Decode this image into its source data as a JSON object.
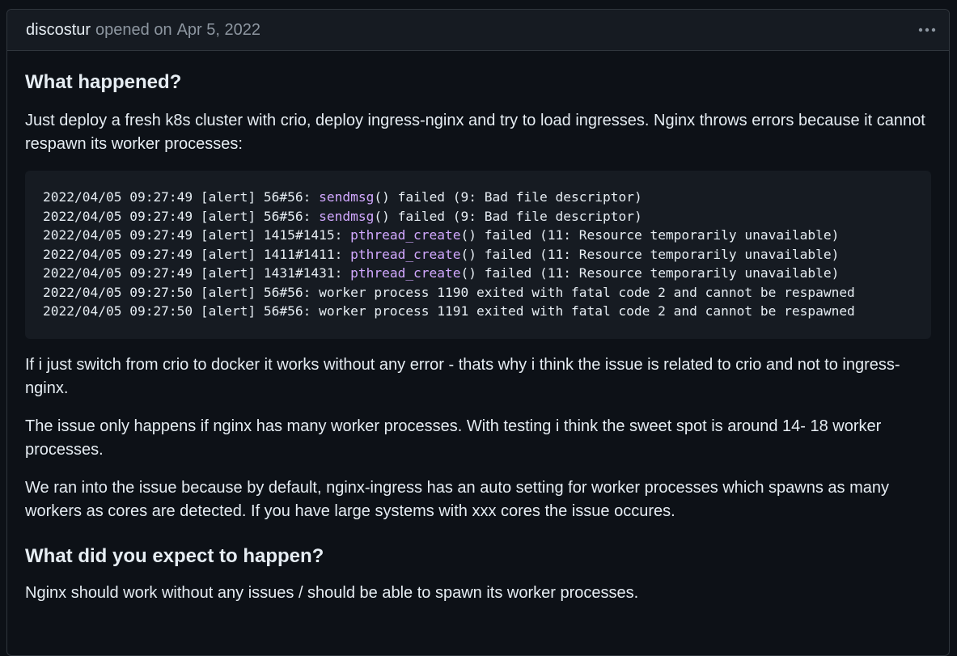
{
  "header": {
    "author": "discostur",
    "action": "opened on",
    "date": "Apr 5, 2022",
    "menu_icon": "kebab-horizontal-icon"
  },
  "body": {
    "heading1": "What happened?",
    "para1": "Just deploy a fresh k8s cluster with crio, deploy ingress-nginx and try to load ingresses. Nginx throws errors because it cannot respawn its worker processes:",
    "code_lines": [
      {
        "pre": "2022/04/05 09:27:49 [alert] 56#56: ",
        "fn": "sendmsg",
        "post": "() failed (9: Bad file descriptor)"
      },
      {
        "pre": "2022/04/05 09:27:49 [alert] 56#56: ",
        "fn": "sendmsg",
        "post": "() failed (9: Bad file descriptor)"
      },
      {
        "pre": "2022/04/05 09:27:49 [alert] 1415#1415: ",
        "fn": "pthread_create",
        "post": "() failed (11: Resource temporarily unavailable)"
      },
      {
        "pre": "2022/04/05 09:27:49 [alert] 1411#1411: ",
        "fn": "pthread_create",
        "post": "() failed (11: Resource temporarily unavailable)"
      },
      {
        "pre": "2022/04/05 09:27:49 [alert] 1431#1431: ",
        "fn": "pthread_create",
        "post": "() failed (11: Resource temporarily unavailable)"
      },
      {
        "pre": "2022/04/05 09:27:50 [alert] 56#56: worker process 1190 exited with fatal code 2 and cannot be respawned",
        "fn": "",
        "post": ""
      },
      {
        "pre": "2022/04/05 09:27:50 [alert] 56#56: worker process 1191 exited with fatal code 2 and cannot be respawned",
        "fn": "",
        "post": ""
      }
    ],
    "para2": "If i just switch from crio to docker it works without any error - thats why i think the issue is related to crio and not to ingress-nginx.",
    "para3": "The issue only happens if nginx has many worker processes. With testing i think the sweet spot is around 14- 18 worker processes.",
    "para4": "We ran into the issue because by default, nginx-ingress has an auto setting for worker processes which spawns as many workers as cores are detected. If you have large systems with xxx cores the issue occures.",
    "heading2": "What did you expect to happen?",
    "para5": "Nginx should work without any issues / should be able to spawn its worker processes."
  },
  "colors": {
    "background": "#0d1117",
    "header_bg": "#161b22",
    "border": "#30363d",
    "muted_text": "#8d96a0",
    "code_function": "#d2a8ff"
  }
}
